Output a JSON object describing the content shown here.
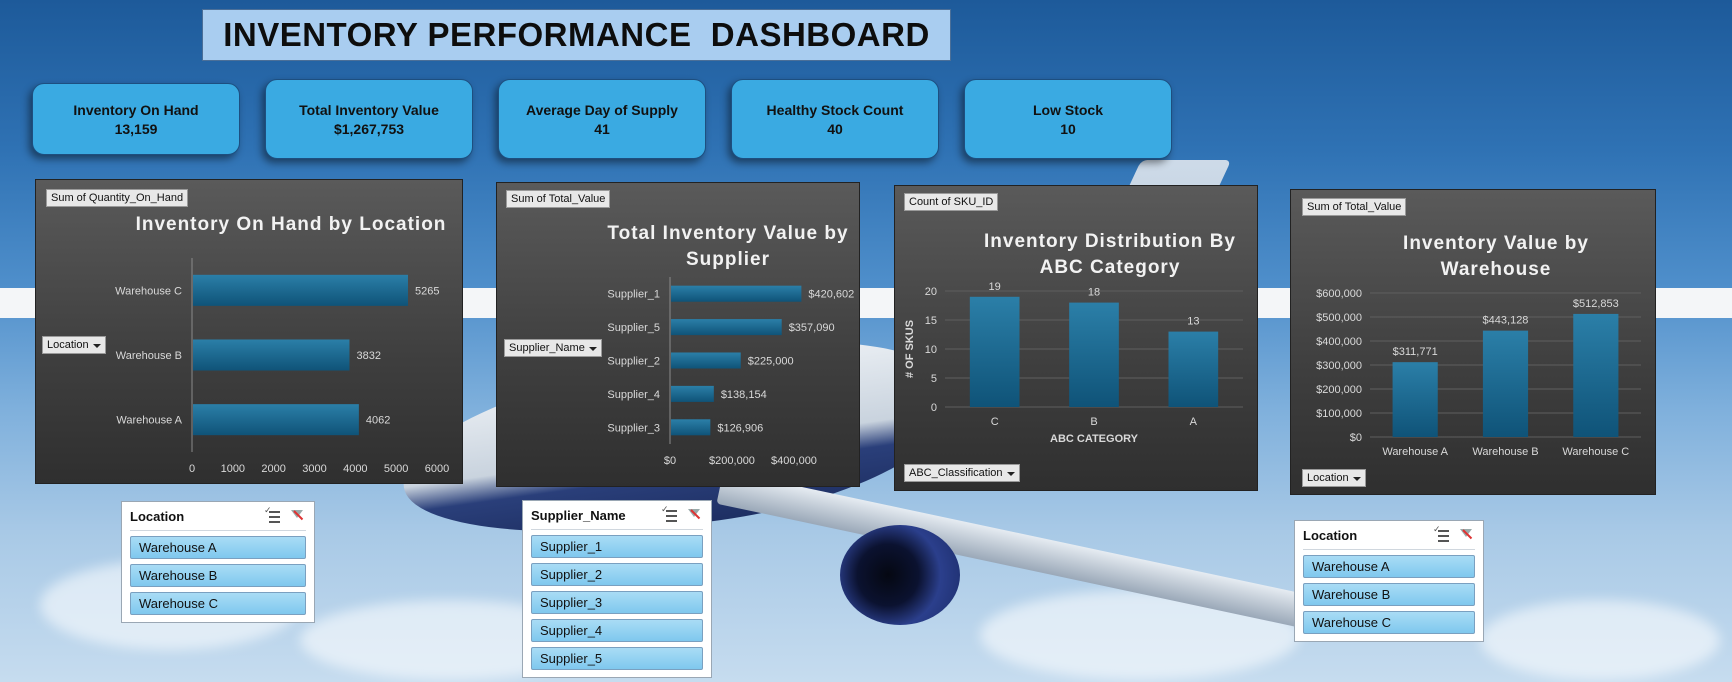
{
  "dashboard_title": "INVENTORY PERFORMANCE  DASHBOARD",
  "kpis": [
    {
      "label": "Inventory On Hand",
      "value": "13,159"
    },
    {
      "label": "Total Inventory Value",
      "value": "$1,267,753"
    },
    {
      "label": "Average Day of Supply",
      "value": "41"
    },
    {
      "label": "Healthy Stock Count",
      "value": "40"
    },
    {
      "label": "Low Stock",
      "value": "10"
    }
  ],
  "colors": {
    "bar_fill_top": "#2b7fa8",
    "bar_fill_bottom": "#0f5378",
    "kpi_bg": "#3aaae2",
    "title_bg": "#a9cdf0",
    "slicer_item_bg": "#84caee",
    "chart_text": "#d9d9d9"
  },
  "panels": {
    "location_chart": {
      "value_field": "Sum of Quantity_On_Hand",
      "filter_field": "Location",
      "title": "Inventory On Hand by Location"
    },
    "supplier_chart": {
      "value_field": "Sum of Total_Value",
      "filter_field": "Supplier_Name",
      "title_line1": "Total Inventory Value by",
      "title_line2": "Supplier"
    },
    "abc_chart": {
      "value_field": "Count of SKU_ID",
      "filter_field": "ABC_Classification",
      "title_line1": "Inventory Distribution By",
      "title_line2": "ABC Category",
      "ylabel": "# OF SKUS",
      "xlabel": "ABC CATEGORY"
    },
    "warehouse_chart": {
      "value_field": "Sum of Total_Value",
      "filter_field": "Location",
      "title_line1": "Inventory Value by",
      "title_line2": "Warehouse"
    }
  },
  "slicers": {
    "location_1": {
      "title": "Location",
      "items": [
        "Warehouse A",
        "Warehouse B",
        "Warehouse C"
      ]
    },
    "supplier": {
      "title": "Supplier_Name",
      "items": [
        "Supplier_1",
        "Supplier_2",
        "Supplier_3",
        "Supplier_4",
        "Supplier_5"
      ]
    },
    "location_2": {
      "title": "Location",
      "items": [
        "Warehouse A",
        "Warehouse B",
        "Warehouse C"
      ]
    }
  },
  "chart_data": [
    {
      "type": "bar",
      "orientation": "horizontal",
      "title": "Inventory On Hand by Location",
      "categories": [
        "Warehouse C",
        "Warehouse B",
        "Warehouse A"
      ],
      "values": [
        5265,
        3832,
        4062
      ],
      "data_labels": [
        "5265",
        "3832",
        "4062"
      ],
      "xlim": [
        0,
        6000
      ],
      "x_ticks": [
        "0",
        "1000",
        "2000",
        "3000",
        "4000",
        "5000",
        "6000"
      ],
      "xlabel": "",
      "ylabel": "",
      "grid": false,
      "legend": "none"
    },
    {
      "type": "bar",
      "orientation": "horizontal",
      "title": "Total Inventory Value by Supplier",
      "categories": [
        "Supplier_1",
        "Supplier_5",
        "Supplier_2",
        "Supplier_4",
        "Supplier_3"
      ],
      "values": [
        420602,
        357090,
        225000,
        138154,
        126906
      ],
      "data_labels": [
        "$420,602",
        "$357,090",
        "$225,000",
        "$138,154",
        "$126,906"
      ],
      "xlim": [
        0,
        400000
      ],
      "x_ticks": [
        "$0",
        "$200,000",
        "$400,000"
      ],
      "xlabel": "",
      "ylabel": "",
      "grid": false,
      "legend": "none"
    },
    {
      "type": "bar",
      "orientation": "vertical",
      "title": "Inventory Distribution By ABC Category",
      "categories": [
        "C",
        "B",
        "A"
      ],
      "values": [
        19,
        18,
        13
      ],
      "data_labels": [
        "19",
        "18",
        "13"
      ],
      "ylim": [
        0,
        20
      ],
      "y_ticks": [
        "0",
        "5",
        "10",
        "15",
        "20"
      ],
      "xlabel": "ABC CATEGORY",
      "ylabel": "# OF SKUS",
      "grid": true,
      "legend": "none"
    },
    {
      "type": "bar",
      "orientation": "vertical",
      "title": "Inventory Value by Warehouse",
      "categories": [
        "Warehouse A",
        "Warehouse B",
        "Warehouse C"
      ],
      "values": [
        311771,
        443128,
        512853
      ],
      "data_labels": [
        "$311,771",
        "$443,128",
        "$512,853"
      ],
      "ylim": [
        0,
        600000
      ],
      "y_ticks": [
        "$0",
        "$100,000",
        "$200,000",
        "$300,000",
        "$400,000",
        "$500,000",
        "$600,000"
      ],
      "xlabel": "",
      "ylabel": "",
      "grid": true,
      "legend": "none"
    }
  ]
}
